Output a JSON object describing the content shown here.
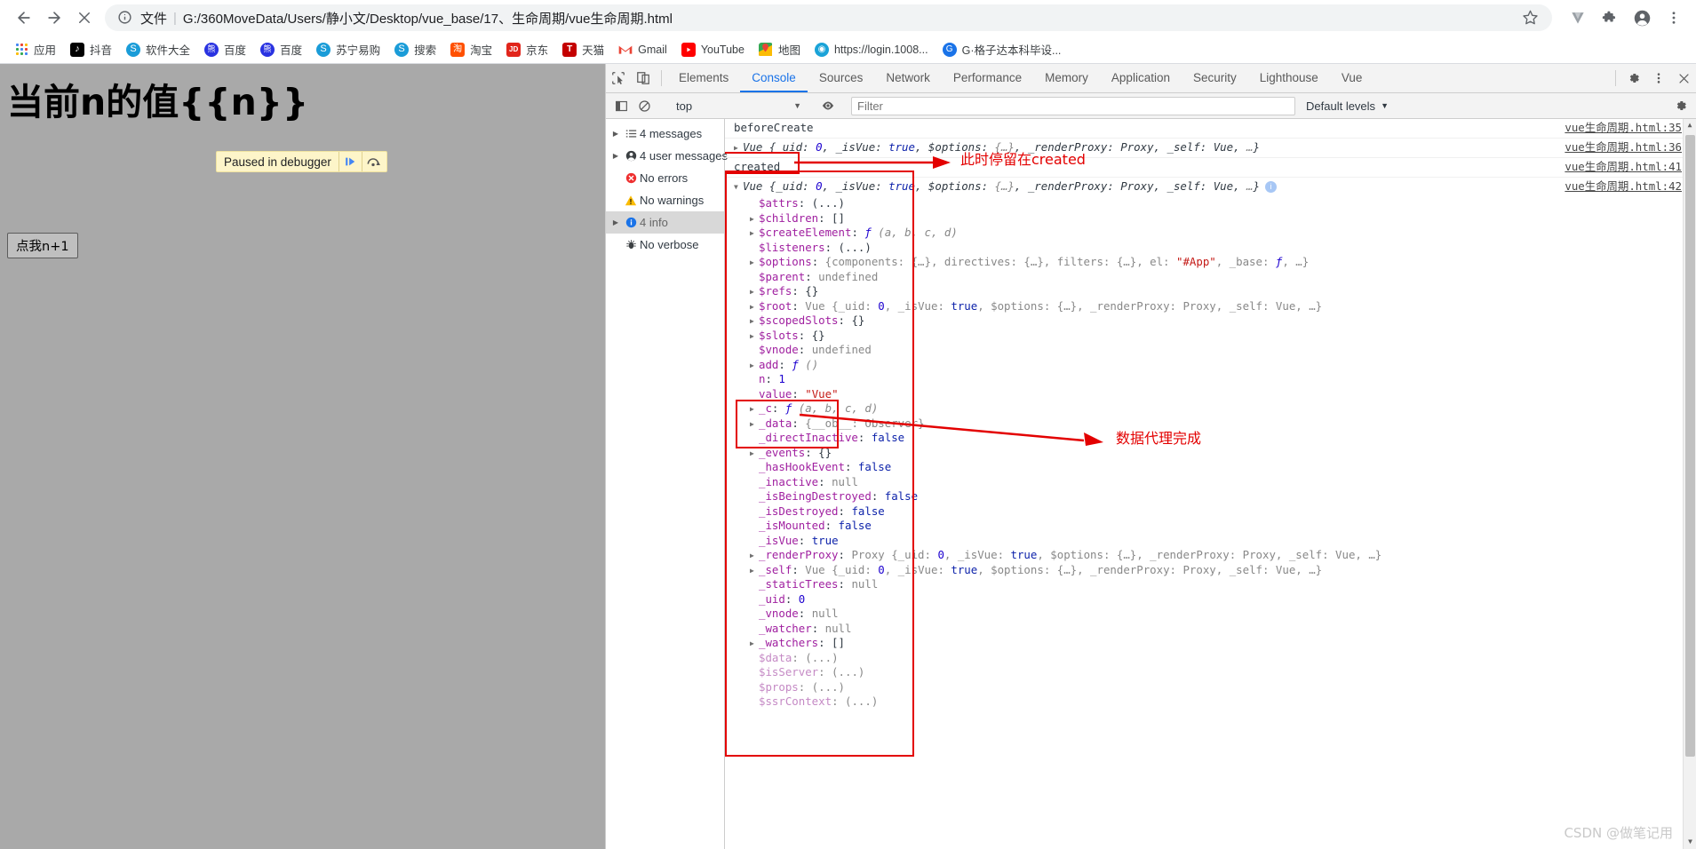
{
  "browser": {
    "nav": {
      "back_icon": "arrow-left-icon",
      "forward_icon": "arrow-right-icon",
      "stop_icon": "close-icon"
    },
    "omnibox": {
      "info_icon": "info-circle-icon",
      "scheme_label": "文件",
      "separator": "|",
      "url": "G:/360MoveData/Users/静小文/Desktop/vue_base/17、生命周期/vue生命周期.html",
      "star_icon": "bookmark-star-icon"
    },
    "toolbar_icons": [
      {
        "name": "extension-v-icon",
        "glyph": "V"
      },
      {
        "name": "puzzle-extensions-icon",
        "glyph": "✦"
      },
      {
        "name": "profile-avatar-icon",
        "glyph": "●"
      },
      {
        "name": "chrome-menu-icon",
        "glyph": "⋮"
      }
    ],
    "bookmarks": [
      {
        "label": "应用",
        "icon": "apps-grid-icon",
        "color": "#4285f4"
      },
      {
        "label": "抖音",
        "icon": "douyin-icon",
        "color": "#010101"
      },
      {
        "label": "软件大全",
        "icon": "globe-icon",
        "color": "#1a9cd8"
      },
      {
        "label": "百度",
        "icon": "baidu-paw-icon",
        "color": "#2932e1"
      },
      {
        "label": "百度",
        "icon": "baidu-paw-icon",
        "color": "#2932e1"
      },
      {
        "label": "苏宁易购",
        "icon": "globe-icon",
        "color": "#1a9cd8"
      },
      {
        "label": "搜索",
        "icon": "globe-icon",
        "color": "#1a9cd8"
      },
      {
        "label": "淘宝",
        "icon": "taobao-icon",
        "color": "#ff5000"
      },
      {
        "label": "京东",
        "icon": "jd-icon",
        "color": "#e1251b"
      },
      {
        "label": "天猫",
        "icon": "tmall-icon",
        "color": "#c40000"
      },
      {
        "label": "Gmail",
        "icon": "gmail-icon",
        "color": "#ea4335"
      },
      {
        "label": "YouTube",
        "icon": "youtube-icon",
        "color": "#ff0000"
      },
      {
        "label": "地图",
        "icon": "google-maps-icon",
        "color": "#34a853"
      },
      {
        "label": "https://login.1008...",
        "icon": "globe-swirl-icon",
        "color": "#1a9cd8"
      },
      {
        "label": "G·格子达本科毕设...",
        "icon": "blue-circle-icon",
        "color": "#1a73e8"
      }
    ]
  },
  "page": {
    "heading": "当前n的值{{n}}",
    "button_label": "点我n+1",
    "paused_banner": {
      "text": "Paused in debugger",
      "resume_icon": "resume-script-icon",
      "step_over_icon": "step-over-icon"
    },
    "background_color": "#a9a9a9"
  },
  "devtools": {
    "left_tools": [
      {
        "name": "inspect-element-icon"
      },
      {
        "name": "toggle-device-toolbar-icon"
      }
    ],
    "tabs": [
      {
        "label": "Elements",
        "active": false
      },
      {
        "label": "Console",
        "active": true
      },
      {
        "label": "Sources",
        "active": false
      },
      {
        "label": "Network",
        "active": false
      },
      {
        "label": "Performance",
        "active": false
      },
      {
        "label": "Memory",
        "active": false
      },
      {
        "label": "Application",
        "active": false
      },
      {
        "label": "Security",
        "active": false
      },
      {
        "label": "Lighthouse",
        "active": false
      },
      {
        "label": "Vue",
        "active": false
      }
    ],
    "right_icons": [
      {
        "name": "settings-gear-icon"
      },
      {
        "name": "devtools-more-options-icon"
      },
      {
        "name": "devtools-close-icon"
      }
    ],
    "accent_color": "#1a73e8",
    "filterbar": {
      "sidebar_toggle_icon": "console-sidebar-toggle-icon",
      "clear_console_icon": "clear-console-icon",
      "context_value": "top",
      "eye_icon": "live-expression-eye-icon",
      "filter_placeholder": "Filter",
      "filter_value": "",
      "levels_value": "Default levels"
    },
    "sidebar": [
      {
        "label": "4 messages",
        "icon": "list-messages-icon",
        "expandable": true,
        "selected": false
      },
      {
        "label": "4 user messages",
        "icon": "user-messages-icon",
        "expandable": true,
        "selected": false
      },
      {
        "label": "No errors",
        "icon": "error-circle-icon",
        "expandable": false,
        "selected": false
      },
      {
        "label": "No warnings",
        "icon": "warning-triangle-icon",
        "expandable": false,
        "selected": false
      },
      {
        "label": "4 info",
        "icon": "info-circle-icon",
        "expandable": true,
        "selected": true
      },
      {
        "label": "No verbose",
        "icon": "verbose-bug-icon",
        "expandable": false,
        "selected": false
      }
    ],
    "messages": [
      {
        "text": "beforeCreate",
        "source": "vue生命周期.html:35"
      },
      {
        "text": "Vue {_uid: 0, _isVue: true, $options: {…}, _renderProxy: Proxy, _self: Vue, …}",
        "source": "vue生命周期.html:36",
        "collapsed": true
      },
      {
        "text": "created",
        "source": "vue生命周期.html:41"
      },
      {
        "text": "Vue {_uid: 0, _isVue: true, $options: {…}, _renderProxy: Proxy, _self: Vue, …}",
        "source": "vue生命周期.html:42",
        "expanded": true
      }
    ],
    "object_properties": [
      {
        "key": "$attrs",
        "value": "(...)",
        "tri": false,
        "dim": false
      },
      {
        "key": "$children",
        "value": "[]",
        "tri": true
      },
      {
        "key": "$createElement",
        "value": "ƒ (a, b, c, d)",
        "tri": true
      },
      {
        "key": "$listeners",
        "value": "(...)",
        "tri": false
      },
      {
        "key": "$options",
        "value": "{components: {…}, directives: {…}, filters: {…}, el: \"#App\", _base: ƒ, …}",
        "tri": true
      },
      {
        "key": "$parent",
        "value": "undefined",
        "tri": false
      },
      {
        "key": "$refs",
        "value": "{}",
        "tri": true
      },
      {
        "key": "$root",
        "value": "Vue {_uid: 0, _isVue: true, $options: {…}, _renderProxy: Proxy, _self: Vue, …}",
        "tri": true
      },
      {
        "key": "$scopedSlots",
        "value": "{}",
        "tri": true
      },
      {
        "key": "$slots",
        "value": "{}",
        "tri": true
      },
      {
        "key": "$vnode",
        "value": "undefined",
        "tri": false
      },
      {
        "key": "add",
        "value": "ƒ ()",
        "tri": true
      },
      {
        "key": "n",
        "value": "1",
        "tri": false
      },
      {
        "key": "value",
        "value": "\"Vue\"",
        "tri": false
      },
      {
        "key": "_c",
        "value": "ƒ (a, b, c, d)",
        "tri": true
      },
      {
        "key": "_data",
        "value": "{__ob__: Observer}",
        "tri": true
      },
      {
        "key": "_directInactive",
        "value": "false",
        "tri": false
      },
      {
        "key": "_events",
        "value": "{}",
        "tri": true
      },
      {
        "key": "_hasHookEvent",
        "value": "false",
        "tri": false
      },
      {
        "key": "_inactive",
        "value": "null",
        "tri": false
      },
      {
        "key": "_isBeingDestroyed",
        "value": "false",
        "tri": false
      },
      {
        "key": "_isDestroyed",
        "value": "false",
        "tri": false
      },
      {
        "key": "_isMounted",
        "value": "false",
        "tri": false
      },
      {
        "key": "_isVue",
        "value": "true",
        "tri": false
      },
      {
        "key": "_renderProxy",
        "value": "Proxy {_uid: 0, _isVue: true, $options: {…}, _renderProxy: Proxy, _self: Vue, …}",
        "tri": true
      },
      {
        "key": "_self",
        "value": "Vue {_uid: 0, _isVue: true, $options: {…}, _renderProxy: Proxy, _self: Vue, …}",
        "tri": true
      },
      {
        "key": "_staticTrees",
        "value": "null",
        "tri": false
      },
      {
        "key": "_uid",
        "value": "0",
        "tri": false
      },
      {
        "key": "_vnode",
        "value": "null",
        "tri": false
      },
      {
        "key": "_watcher",
        "value": "null",
        "tri": false
      },
      {
        "key": "_watchers",
        "value": "[]",
        "tri": true
      },
      {
        "key": "$data",
        "value": "(...)",
        "tri": false,
        "dim": true
      },
      {
        "key": "$isServer",
        "value": "(...)",
        "tri": false,
        "dim": true
      },
      {
        "key": "$props",
        "value": "(...)",
        "tri": false,
        "dim": true
      },
      {
        "key": "$ssrContext",
        "value": "(...)",
        "tri": false,
        "dim": true
      }
    ]
  },
  "annotations": {
    "color": "#e30000",
    "created_label": "此时停留在created",
    "data_proxy_label": "数据代理完成"
  },
  "watermark": "CSDN @做笔记用"
}
